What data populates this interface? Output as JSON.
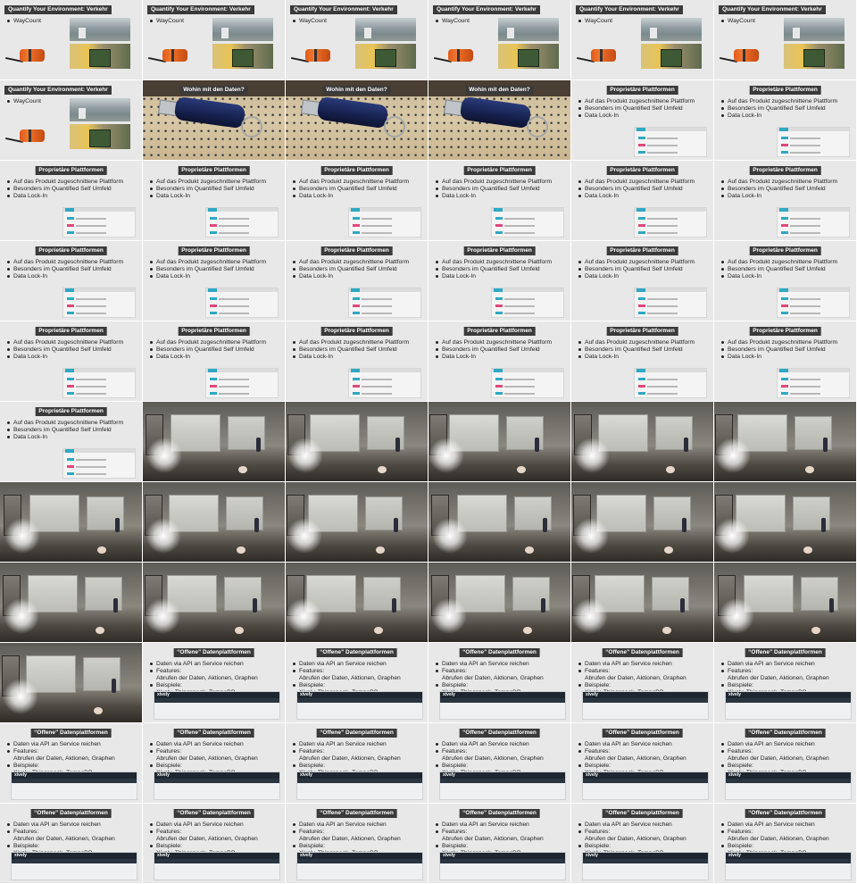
{
  "grid": {
    "columns": 6,
    "rows": 11
  },
  "slides": {
    "waycount": {
      "title": "Quantify Your Environment: Verkehr",
      "bullets": [
        "WayCount"
      ]
    },
    "usb": {
      "title": "Wohin mit den Daten?"
    },
    "proprietary": {
      "title": "Proprietäre Plattformen",
      "bullets": [
        "Auf das Produkt zugeschnittene Plattform",
        "Besonders im Quantified Self Umfeld",
        "Data Lock-In"
      ]
    },
    "open": {
      "title": "“Offene” Datenplattformen",
      "bullets": [
        "Daten via API an Service reichen",
        "Features:\nAbrufen der Daten, Aktionen, Graphen",
        "Beispiele:\nXively, Thingspeak, TempoDB"
      ],
      "xively_logo": "xively"
    }
  },
  "cells": [
    "waycount",
    "waycount",
    "waycount",
    "waycount",
    "waycount",
    "waycount",
    "waycount",
    "usb",
    "usb",
    "usb",
    "proprietary",
    "proprietary",
    "proprietary",
    "proprietary",
    "proprietary",
    "proprietary",
    "proprietary",
    "proprietary",
    "proprietary",
    "proprietary",
    "proprietary",
    "proprietary",
    "proprietary",
    "proprietary",
    "proprietary",
    "proprietary",
    "proprietary",
    "proprietary",
    "proprietary",
    "proprietary",
    "proprietary",
    "photo",
    "photo",
    "photo",
    "photo",
    "photo",
    "photo",
    "photo",
    "photo",
    "photo",
    "photo",
    "photo",
    "photo",
    "photo",
    "photo",
    "photo",
    "photo",
    "photo",
    "photo",
    "open",
    "open",
    "open",
    "open",
    "open",
    "open",
    "open",
    "open",
    "open",
    "open",
    "open",
    "open",
    "open",
    "open",
    "open",
    "open",
    "open"
  ]
}
